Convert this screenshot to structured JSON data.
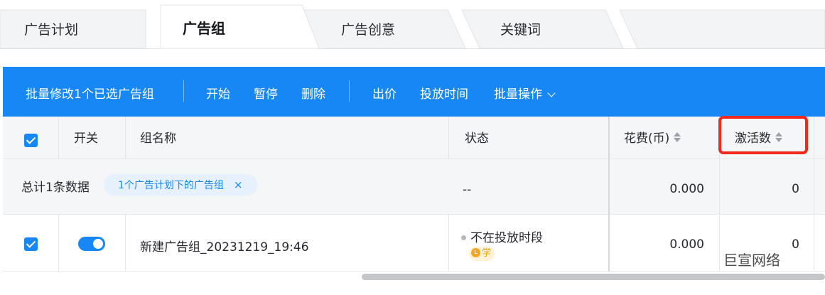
{
  "tabs": {
    "plan": "广告计划",
    "group": "广告组",
    "creative": "广告创意",
    "keywords": "关键词"
  },
  "toolbar": {
    "batch_edit": "批量修改1个已选广告组",
    "start": "开始",
    "pause": "暂停",
    "delete": "删除",
    "bid": "出价",
    "schedule": "投放时间",
    "batch_ops": "批量操作"
  },
  "table": {
    "headers": {
      "switch": "开关",
      "group_name": "组名称",
      "status": "状态",
      "cost": "花费(币)",
      "activations": "激活数"
    },
    "total_row": {
      "label": "总计1条数据",
      "filter_chip": "1个广告计划下的广告组",
      "chip_close": "×",
      "status": "--",
      "cost": "0.000",
      "activations": "0"
    },
    "rows": [
      {
        "name": "新建广告组_20231219_19:46",
        "status": "不在投放时段",
        "badge": "学",
        "cost": "0.000",
        "activations": "0",
        "switch_on": true,
        "selected": true
      }
    ]
  },
  "watermark": "巨宣网络",
  "colors": {
    "accent": "#1787f5",
    "highlight_box": "#f0291d",
    "header_bg": "#f5f6f7"
  },
  "icons": [
    "checkbox-checked-icon",
    "sort-icon",
    "chevron-down-icon",
    "clock-icon",
    "close-icon"
  ]
}
